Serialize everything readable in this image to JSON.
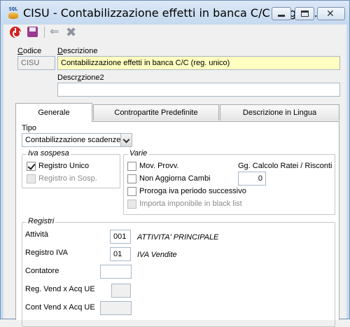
{
  "window": {
    "title": "CISU - Contabilizzazione effetti in banca C/C (reg. u...",
    "app_icon_text": "SQL"
  },
  "toolbar": {
    "icons": [
      "power-icon",
      "save-icon",
      "undo-icon",
      "delete-icon"
    ]
  },
  "form": {
    "codice_label": "Codice",
    "codice_value": "CISU",
    "descrizione_label": "Descrizione",
    "descrizione_value": "Contabilizzazione effetti in banca C/C (reg. unico)",
    "descrizione2_label": "Descrizione2",
    "descrizione2_value": ""
  },
  "tabs": [
    {
      "label": "Generale",
      "active": true
    },
    {
      "label": "Contropartite Predefinite",
      "active": false
    },
    {
      "label": "Descrizione in Lingua",
      "active": false
    }
  ],
  "generale": {
    "tipo_label": "Tipo",
    "tipo_value": "Contabilizzazione scadenze",
    "iva_sospesa": {
      "title": "Iva sospesa",
      "registro_unico": {
        "label": "Registro Unico",
        "checked": true,
        "enabled": true
      },
      "registro_in_sosp": {
        "label": "Registro in Sosp.",
        "checked": false,
        "enabled": false
      }
    },
    "varie": {
      "title": "Varie",
      "mov_provv": {
        "label": "Mov. Provv.",
        "checked": false
      },
      "non_aggiorna_cambi": {
        "label": "Non Aggiorna Cambi",
        "checked": false
      },
      "proroga_iva": {
        "label": "Proroga iva periodo successivo",
        "checked": false
      },
      "importa_imponibile": {
        "label": "Importa imponibile in black list",
        "checked": false,
        "enabled": false
      },
      "gg_calcolo_label": "Gg. Calcolo Ratei / Risconti",
      "gg_calcolo_value": "0"
    },
    "registri": {
      "title": "Registri",
      "attivita_label": "Attività",
      "attivita_code": "001",
      "attivita_desc": "ATTIVITA' PRINCIPALE",
      "registro_iva_label": "Registro IVA",
      "registro_iva_code": "01",
      "registro_iva_desc": "IVA Vendite",
      "contatore_label": "Contatore",
      "contatore_value": "",
      "reg_vend_label": "Reg. Vend x Acq UE",
      "reg_vend_value": "",
      "cont_vend_label": "Cont Vend x Acq UE",
      "cont_vend_value": ""
    }
  }
}
